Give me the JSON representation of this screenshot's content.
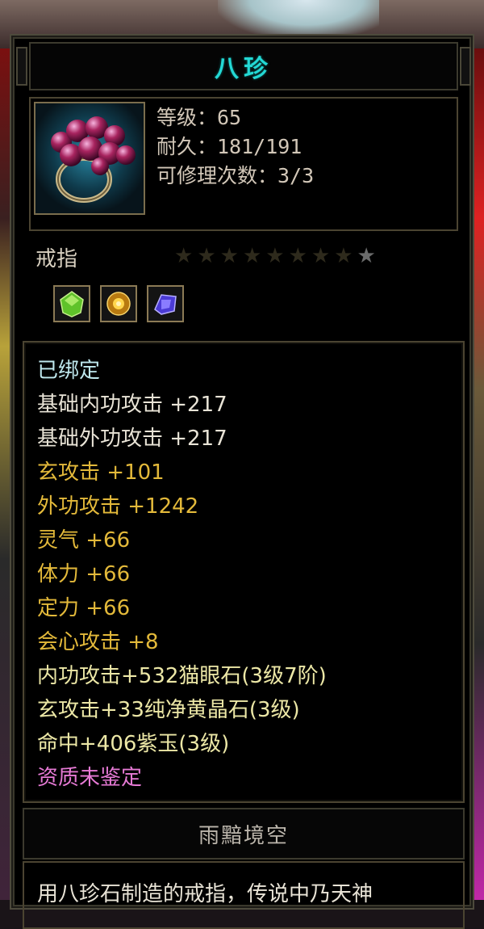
{
  "item": {
    "name": "八珍",
    "level": "等级：65",
    "durability": "耐久：181/191",
    "repairs": "可修理次数：3/3",
    "type": "戒指",
    "stars": {
      "total": 9,
      "lit": 1
    },
    "gems": [
      "green-gem-icon",
      "amber-gem-icon",
      "purple-gem-icon"
    ]
  },
  "attributes": [
    {
      "text": "已绑定",
      "color": "cyan"
    },
    {
      "text": "基础内功攻击 +217",
      "color": "white"
    },
    {
      "text": "基础外功攻击 +217",
      "color": "white"
    },
    {
      "text": "玄攻击 +101",
      "color": "gold"
    },
    {
      "text": "外功攻击 +1242",
      "color": "gold"
    },
    {
      "text": "灵气 +66",
      "color": "gold"
    },
    {
      "text": "体力 +66",
      "color": "gold"
    },
    {
      "text": "定力 +66",
      "color": "gold"
    },
    {
      "text": "会心攻击 +8",
      "color": "gold"
    },
    {
      "text": "内功攻击+532猫眼石(3级7阶)",
      "color": "yellow"
    },
    {
      "text": "玄攻击+33纯净黄晶石(3级)",
      "color": "yellow"
    },
    {
      "text": "命中+406紫玉(3级)",
      "color": "yellow"
    },
    {
      "text": "资质未鉴定",
      "color": "pink"
    }
  ],
  "suite": {
    "name": "雨黯境空"
  },
  "description": "用八珍石制造的戒指，传说中乃天神"
}
